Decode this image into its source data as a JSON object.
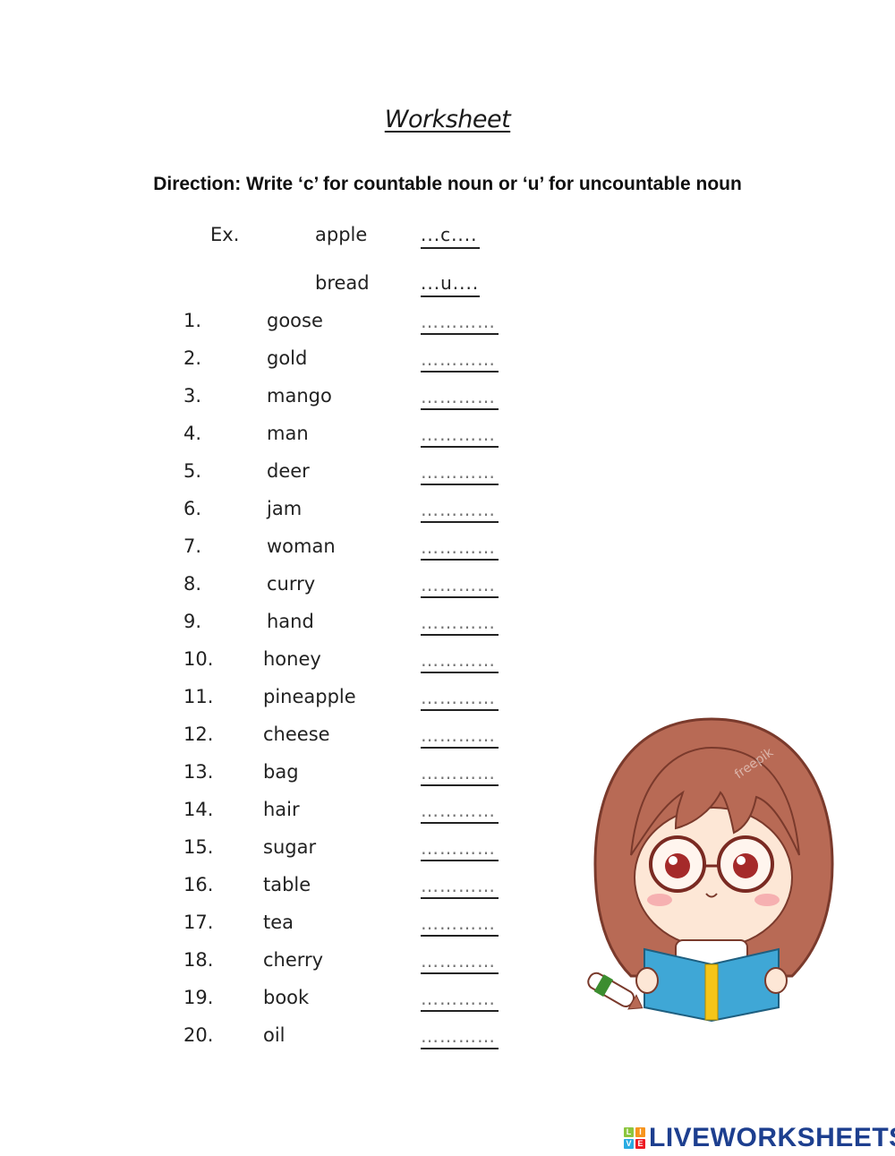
{
  "worksheet": {
    "title": "Worksheet",
    "direction": "Direction: Write ‘c’ for countable noun or ‘u’ for uncountable noun"
  },
  "examples": [
    {
      "label": "Ex.",
      "word": "apple",
      "answer": "...c...."
    },
    {
      "label": "",
      "word": "bread",
      "answer": "...u...."
    }
  ],
  "items": [
    {
      "num": "1.",
      "word": "goose",
      "answer": "",
      "placeholder": "…………"
    },
    {
      "num": "2.",
      "word": "gold",
      "answer": "",
      "placeholder": "…………"
    },
    {
      "num": "3.",
      "word": "mango",
      "answer": "",
      "placeholder": "…………"
    },
    {
      "num": "4.",
      "word": "man",
      "answer": "",
      "placeholder": "…………"
    },
    {
      "num": "5.",
      "word": "deer",
      "answer": "",
      "placeholder": "…………"
    },
    {
      "num": "6.",
      "word": "jam",
      "answer": "",
      "placeholder": "…………"
    },
    {
      "num": "7.",
      "word": "woman",
      "answer": "",
      "placeholder": "…………"
    },
    {
      "num": "8.",
      "word": "curry",
      "answer": "",
      "placeholder": "…………"
    },
    {
      "num": "9.",
      "word": "hand",
      "answer": "",
      "placeholder": "…………"
    },
    {
      "num": "10.",
      "word": "honey",
      "answer": "",
      "placeholder": "…………"
    },
    {
      "num": "11.",
      "word": "pineapple",
      "answer": "",
      "placeholder": "…………"
    },
    {
      "num": "12.",
      "word": "cheese",
      "answer": "",
      "placeholder": "…………"
    },
    {
      "num": "13.",
      "word": "bag",
      "answer": "",
      "placeholder": "…………"
    },
    {
      "num": "14.",
      "word": "hair",
      "answer": "",
      "placeholder": "…………"
    },
    {
      "num": "15.",
      "word": "sugar",
      "answer": "",
      "placeholder": "…………"
    },
    {
      "num": "16.",
      "word": "table",
      "answer": "",
      "placeholder": "…………"
    },
    {
      "num": "17.",
      "word": "tea",
      "answer": "",
      "placeholder": "…………"
    },
    {
      "num": "18.",
      "word": "cherry",
      "answer": "",
      "placeholder": "…………"
    },
    {
      "num": "19.",
      "word": "book",
      "answer": "",
      "placeholder": "…………"
    },
    {
      "num": "20.",
      "word": "oil",
      "answer": "",
      "placeholder": "…………"
    }
  ],
  "illustration": {
    "icon": "girl-reading-book-icon",
    "watermark": "freepik"
  },
  "branding": {
    "logo_letters": [
      "L",
      "I",
      "V",
      "E"
    ],
    "logo_colors": [
      "#8cc63f",
      "#f7941d",
      "#29abe2",
      "#ed1c24"
    ],
    "logo_text": "LIVEWORKSHEETS",
    "logo_color": "#1d3f8f"
  }
}
